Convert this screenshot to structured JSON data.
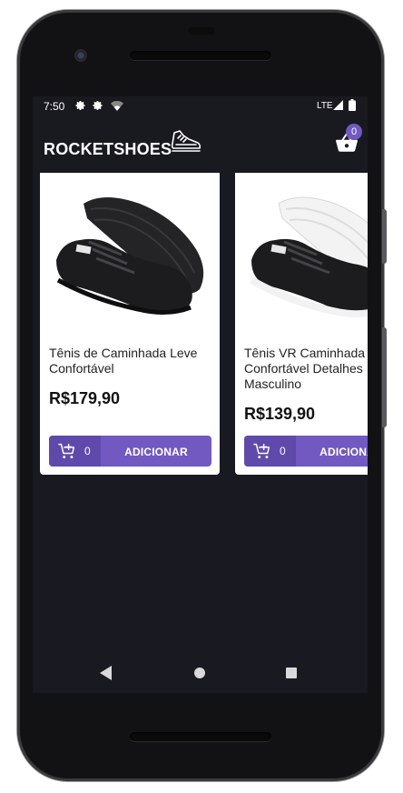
{
  "statusbar": {
    "time": "7:50",
    "network": "LTE"
  },
  "header": {
    "brand": "ROCKETSHOES",
    "cart_count": "0"
  },
  "products": [
    {
      "title": "Tênis de Caminhada Leve Confortável",
      "price": "R$179,90",
      "in_cart": "0",
      "add_label": "ADICIONAR",
      "shoe_color": "black"
    },
    {
      "title": "Tênis VR Caminhada Confortável Detalhes Masculino",
      "price": "R$139,90",
      "in_cart": "0",
      "add_label": "ADICIONAR",
      "shoe_color": "black-white"
    }
  ],
  "colors": {
    "background": "#191920",
    "accent": "#7159c1",
    "accent_dark": "#5f4aab",
    "card": "#ffffff"
  },
  "icons": {
    "status": [
      "settings-icon",
      "settings-icon",
      "wifi-icon",
      "lte-signal-icon",
      "battery-icon"
    ],
    "header": [
      "shoe-logo-icon",
      "shopping-basket-icon"
    ],
    "card": [
      "add-shopping-cart-icon"
    ],
    "nav": [
      "back-icon",
      "home-icon",
      "recents-icon"
    ]
  }
}
